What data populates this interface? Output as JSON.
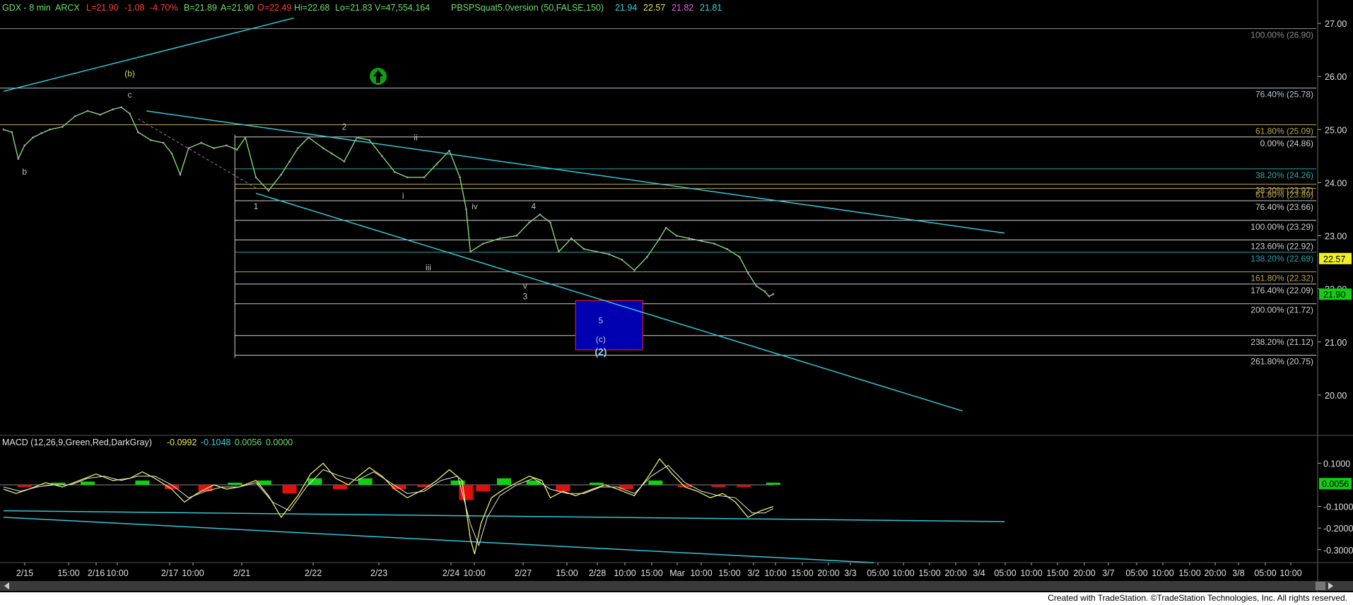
{
  "chart_data": {
    "type": "line",
    "header": {
      "symbol": "GDX - 8 min",
      "exchange": "ARCX",
      "last": "L=21.90",
      "change": "-1.08",
      "change_pct": "-4.70%",
      "bid": "B=21.89",
      "ask": "A=21.90",
      "open": "O=22.49",
      "high": "Hi=22.68",
      "low": "Lo=21.83",
      "volume": "V=47,554,164",
      "indicator": "PBSPSquat5.0version (50,FALSE,150)",
      "ind_vals": [
        "21.94",
        "22.57",
        "21.82",
        "21.81"
      ]
    },
    "price_axis": {
      "min": 19.4,
      "max": 27.2,
      "ticks": [
        "27.00",
        "26.00",
        "25.00",
        "24.00",
        "23.00",
        "22.00",
        "21.00",
        "20.00"
      ],
      "last_tag": "21.90",
      "tag_2257": "22.57"
    },
    "time_ticks": [
      "2/15",
      "15:00",
      "2/16",
      "10:00",
      "2/17",
      "10:00",
      "2/21",
      "2/22",
      "2/23",
      "2/24",
      "10:00",
      "2/27",
      "15:00",
      "2/28",
      "10:00",
      "15:00",
      "Mar",
      "10:00",
      "15:00",
      "3/2",
      "10:00",
      "15:00",
      "20:00",
      "3/3",
      "05:00",
      "10:00",
      "15:00",
      "20:00",
      "3/4",
      "05:00",
      "10:00",
      "15:00",
      "20:00",
      "3/7",
      "05:00",
      "10:00",
      "15:00",
      "20:00",
      "3/8",
      "05:00",
      "10:00"
    ],
    "price_path": [
      [
        0,
        25.0
      ],
      [
        0.2,
        24.95
      ],
      [
        0.35,
        24.45
      ],
      [
        0.5,
        24.7
      ],
      [
        0.7,
        24.85
      ],
      [
        0.9,
        24.93
      ],
      [
        1.1,
        25.0
      ],
      [
        1.4,
        25.05
      ],
      [
        1.7,
        25.25
      ],
      [
        2.0,
        25.35
      ],
      [
        2.3,
        25.28
      ],
      [
        2.6,
        25.38
      ],
      [
        2.8,
        25.42
      ],
      [
        3.0,
        25.3
      ],
      [
        3.2,
        24.95
      ],
      [
        3.5,
        24.8
      ],
      [
        3.8,
        24.75
      ],
      [
        4.0,
        24.55
      ],
      [
        4.2,
        24.15
      ],
      [
        4.4,
        24.65
      ],
      [
        4.7,
        24.75
      ],
      [
        5.0,
        24.65
      ],
      [
        5.3,
        24.7
      ],
      [
        5.55,
        24.62
      ],
      [
        5.75,
        24.85
      ],
      [
        6.0,
        24.1
      ],
      [
        6.3,
        23.85
      ],
      [
        6.6,
        24.15
      ],
      [
        6.8,
        24.4
      ],
      [
        7.0,
        24.65
      ],
      [
        7.25,
        24.85
      ],
      [
        7.6,
        24.65
      ],
      [
        7.8,
        24.55
      ],
      [
        8.1,
        24.4
      ],
      [
        8.4,
        24.85
      ],
      [
        8.7,
        24.8
      ],
      [
        9.0,
        24.5
      ],
      [
        9.3,
        24.2
      ],
      [
        9.6,
        24.1
      ],
      [
        10.0,
        24.1
      ],
      [
        10.3,
        24.35
      ],
      [
        10.6,
        24.6
      ],
      [
        10.85,
        24.1
      ],
      [
        11.0,
        23.5
      ],
      [
        11.1,
        22.7
      ],
      [
        11.4,
        22.85
      ],
      [
        11.8,
        22.95
      ],
      [
        12.2,
        23.0
      ],
      [
        12.5,
        23.25
      ],
      [
        12.75,
        23.4
      ],
      [
        13.0,
        23.25
      ],
      [
        13.2,
        22.7
      ],
      [
        13.5,
        22.95
      ],
      [
        13.8,
        22.75
      ],
      [
        14.1,
        22.7
      ],
      [
        14.4,
        22.65
      ],
      [
        14.7,
        22.55
      ],
      [
        15.0,
        22.35
      ],
      [
        15.3,
        22.6
      ],
      [
        15.6,
        22.95
      ],
      [
        15.75,
        23.15
      ],
      [
        16.0,
        23.0
      ],
      [
        16.3,
        22.95
      ],
      [
        16.6,
        22.9
      ],
      [
        16.9,
        22.85
      ],
      [
        17.2,
        22.75
      ],
      [
        17.5,
        22.6
      ],
      [
        17.7,
        22.3
      ],
      [
        17.9,
        22.05
      ],
      [
        18.1,
        21.95
      ],
      [
        18.2,
        21.86
      ],
      [
        18.3,
        21.9
      ]
    ],
    "macd": {
      "label": "MACD (12,26,9,Green,Red,DarkGray)",
      "values": [
        "-0.0992",
        "-0.1048",
        "0.0056",
        "0.0000"
      ],
      "min": -0.34,
      "max": 0.16,
      "ticks": [
        "0.1000",
        "-0.1000",
        "-0.2000",
        "-0.3000"
      ],
      "last_tag": "0.0056",
      "macd_line": [
        [
          0,
          -0.02
        ],
        [
          0.3,
          -0.04
        ],
        [
          0.6,
          -0.02
        ],
        [
          1.0,
          0.01
        ],
        [
          1.4,
          -0.01
        ],
        [
          1.8,
          0.02
        ],
        [
          2.2,
          0.05
        ],
        [
          2.6,
          0.02
        ],
        [
          3.0,
          0.03
        ],
        [
          3.3,
          0.06
        ],
        [
          3.6,
          0.03
        ],
        [
          4.0,
          -0.02
        ],
        [
          4.3,
          -0.08
        ],
        [
          4.6,
          -0.04
        ],
        [
          5.0,
          0.0
        ],
        [
          5.3,
          -0.02
        ],
        [
          5.6,
          -0.01
        ],
        [
          6.0,
          0.02
        ],
        [
          6.3,
          -0.05
        ],
        [
          6.6,
          -0.15
        ],
        [
          7.0,
          -0.05
        ],
        [
          7.3,
          0.05
        ],
        [
          7.6,
          0.1
        ],
        [
          7.9,
          0.03
        ],
        [
          8.2,
          0.0
        ],
        [
          8.5,
          0.05
        ],
        [
          8.7,
          0.08
        ],
        [
          9.0,
          0.04
        ],
        [
          9.3,
          -0.02
        ],
        [
          9.6,
          -0.06
        ],
        [
          10.0,
          -0.02
        ],
        [
          10.3,
          0.02
        ],
        [
          10.6,
          0.07
        ],
        [
          10.9,
          0.02
        ],
        [
          11.1,
          -0.25
        ],
        [
          11.2,
          -0.32
        ],
        [
          11.35,
          -0.18
        ],
        [
          11.6,
          -0.06
        ],
        [
          11.9,
          -0.02
        ],
        [
          12.2,
          0.01
        ],
        [
          12.5,
          0.04
        ],
        [
          12.8,
          0.02
        ],
        [
          13.0,
          -0.06
        ],
        [
          13.3,
          -0.03
        ],
        [
          13.6,
          -0.05
        ],
        [
          14.0,
          -0.02
        ],
        [
          14.3,
          0.0
        ],
        [
          14.6,
          -0.02
        ],
        [
          15.0,
          -0.05
        ],
        [
          15.3,
          0.03
        ],
        [
          15.6,
          0.12
        ],
        [
          15.9,
          0.05
        ],
        [
          16.2,
          -0.01
        ],
        [
          16.5,
          -0.03
        ],
        [
          16.8,
          -0.06
        ],
        [
          17.1,
          -0.04
        ],
        [
          17.4,
          -0.08
        ],
        [
          17.7,
          -0.15
        ],
        [
          18.0,
          -0.12
        ],
        [
          18.3,
          -0.1
        ]
      ],
      "signal_line": [
        [
          0,
          -0.01
        ],
        [
          0.4,
          -0.03
        ],
        [
          0.8,
          -0.01
        ],
        [
          1.2,
          0.0
        ],
        [
          1.6,
          0.0
        ],
        [
          2.0,
          0.03
        ],
        [
          2.4,
          0.04
        ],
        [
          2.8,
          0.02
        ],
        [
          3.2,
          0.04
        ],
        [
          3.6,
          0.04
        ],
        [
          4.0,
          0.0
        ],
        [
          4.4,
          -0.06
        ],
        [
          4.8,
          -0.03
        ],
        [
          5.2,
          -0.01
        ],
        [
          5.6,
          -0.01
        ],
        [
          6.0,
          0.01
        ],
        [
          6.4,
          -0.08
        ],
        [
          6.8,
          -0.12
        ],
        [
          7.2,
          -0.01
        ],
        [
          7.6,
          0.07
        ],
        [
          8.0,
          0.04
        ],
        [
          8.4,
          0.02
        ],
        [
          8.8,
          0.06
        ],
        [
          9.2,
          0.01
        ],
        [
          9.6,
          -0.04
        ],
        [
          10.0,
          -0.03
        ],
        [
          10.4,
          0.02
        ],
        [
          10.8,
          0.04
        ],
        [
          11.1,
          -0.18
        ],
        [
          11.3,
          -0.28
        ],
        [
          11.5,
          -0.15
        ],
        [
          11.8,
          -0.05
        ],
        [
          12.2,
          0.0
        ],
        [
          12.6,
          0.03
        ],
        [
          13.0,
          -0.02
        ],
        [
          13.4,
          -0.04
        ],
        [
          13.8,
          -0.04
        ],
        [
          14.2,
          -0.01
        ],
        [
          14.6,
          -0.01
        ],
        [
          15.0,
          -0.04
        ],
        [
          15.4,
          0.04
        ],
        [
          15.8,
          0.09
        ],
        [
          16.2,
          0.01
        ],
        [
          16.6,
          -0.03
        ],
        [
          17.0,
          -0.05
        ],
        [
          17.4,
          -0.06
        ],
        [
          17.8,
          -0.13
        ],
        [
          18.1,
          -0.13
        ],
        [
          18.3,
          -0.11
        ]
      ],
      "hist": [
        [
          0.5,
          -0.01
        ],
        [
          1.3,
          0.01
        ],
        [
          2.0,
          0.015
        ],
        [
          3.3,
          0.02
        ],
        [
          4.0,
          -0.02
        ],
        [
          4.8,
          -0.03
        ],
        [
          5.5,
          0.01
        ],
        [
          6.2,
          0.02
        ],
        [
          6.8,
          -0.04
        ],
        [
          7.4,
          0.03
        ],
        [
          8.0,
          -0.02
        ],
        [
          8.6,
          0.03
        ],
        [
          9.4,
          -0.02
        ],
        [
          10.0,
          -0.01
        ],
        [
          10.8,
          0.02
        ],
        [
          11.0,
          -0.07
        ],
        [
          11.4,
          -0.03
        ],
        [
          11.9,
          0.03
        ],
        [
          12.6,
          0.02
        ],
        [
          13.3,
          -0.03
        ],
        [
          14.1,
          0.01
        ],
        [
          14.8,
          -0.02
        ],
        [
          15.5,
          0.02
        ],
        [
          16.2,
          -0.01
        ],
        [
          17.0,
          -0.01
        ],
        [
          17.6,
          -0.01
        ],
        [
          18.3,
          0.01
        ]
      ]
    },
    "fib_levels": [
      {
        "label": "100.00% (26.90)",
        "value": 26.9,
        "color": "#8a8a8a"
      },
      {
        "label": "76.40% (25.78)",
        "value": 25.78,
        "color": "#b0c4de"
      },
      {
        "label": "61.80% (25.09)",
        "value": 25.09,
        "color": "#b8a850"
      },
      {
        "label": "0.00% (24.86)",
        "value": 24.86,
        "color": "#d0d0d0"
      },
      {
        "label": "38.20% (24.26)",
        "value": 24.26,
        "color": "#2aa8a8"
      },
      {
        "label": "38.20% (23.97)",
        "value": 23.97,
        "color": "#b8a850"
      },
      {
        "label": "61.80% (23.89)",
        "value": 23.89,
        "color": "#b8a850"
      },
      {
        "label": "76.40% (23.66)",
        "value": 23.66,
        "color": "#d0d0d0"
      },
      {
        "label": "100.00% (23.29)",
        "value": 23.29,
        "color": "#d0d0d0"
      },
      {
        "label": "123.60% (22.92)",
        "value": 22.92,
        "color": "#d0d0d0"
      },
      {
        "label": "138.20% (22.69)",
        "value": 22.69,
        "color": "#2aa8a8"
      },
      {
        "label": "161.80% (22.32)",
        "value": 22.32,
        "color": "#b8a850"
      },
      {
        "label": "176.40% (22.09)",
        "value": 22.09,
        "color": "#d0d0d0"
      },
      {
        "label": "200.00% (21.72)",
        "value": 21.72,
        "color": "#d0d0d0"
      },
      {
        "label": "238.20% (21.12)",
        "value": 21.12,
        "color": "#d0d0d0"
      },
      {
        "label": "261.80% (20.75)",
        "value": 20.75,
        "color": "#d0d0d0"
      }
    ],
    "wave_labels": [
      {
        "text": "(b)",
        "t": 3.0,
        "p": 26.0,
        "color": "#d8d870"
      },
      {
        "text": "c",
        "t": 3.0,
        "p": 25.6,
        "color": "#c0c0c0"
      },
      {
        "text": "b",
        "t": 0.5,
        "p": 24.15,
        "color": "#c0c0c0"
      },
      {
        "text": "1",
        "t": 6.0,
        "p": 23.5,
        "color": "#c0c0c0"
      },
      {
        "text": "2",
        "t": 8.1,
        "p": 25.0,
        "color": "#c0c0c0"
      },
      {
        "text": "i",
        "t": 9.5,
        "p": 23.7,
        "color": "#c0c0c0"
      },
      {
        "text": "ii",
        "t": 9.8,
        "p": 24.8,
        "color": "#c0c0c0"
      },
      {
        "text": "iii",
        "t": 10.1,
        "p": 22.35,
        "color": "#c0c0c0"
      },
      {
        "text": "iv",
        "t": 11.2,
        "p": 23.5,
        "color": "#c0c0c0"
      },
      {
        "text": "4",
        "t": 12.6,
        "p": 23.5,
        "color": "#c0c0c0"
      },
      {
        "text": "v",
        "t": 12.4,
        "p": 22.0,
        "color": "#c0c0c0"
      },
      {
        "text": "3",
        "t": 12.4,
        "p": 21.8,
        "color": "#c0c0c0"
      },
      {
        "text": "5",
        "t": 14.2,
        "p": 21.35,
        "color": "#c0c0c0"
      },
      {
        "text": "(c)",
        "t": 14.2,
        "p": 21.0,
        "color": "#c0c0c0"
      },
      {
        "text": "(2)",
        "t": 14.2,
        "p": 20.75,
        "color": "#8ad0ff"
      }
    ],
    "trendlines": [
      {
        "from": [
          0,
          25.72
        ],
        "to": [
          6.9,
          27.1
        ]
      },
      {
        "from": [
          3.4,
          25.35
        ],
        "to": [
          23.8,
          23.05
        ]
      },
      {
        "from": [
          6.0,
          23.8
        ],
        "to": [
          22.8,
          19.7
        ]
      }
    ],
    "macd_trendlines": [
      {
        "from": [
          0,
          -0.12
        ],
        "to": [
          23.8,
          -0.17
        ]
      },
      {
        "from": [
          0,
          -0.15
        ],
        "to": [
          20.7,
          -0.36
        ]
      }
    ],
    "target_box": {
      "t1": 13.6,
      "t2": 15.2,
      "p1": 21.78,
      "p2": 20.85
    },
    "fib_box": {
      "t1": 5.5,
      "t2": 23.2,
      "p1": 24.9,
      "p2": 20.7
    },
    "credit": "Created with TradeStation. ©TradeStation Technologies, Inc. All rights reserved."
  }
}
